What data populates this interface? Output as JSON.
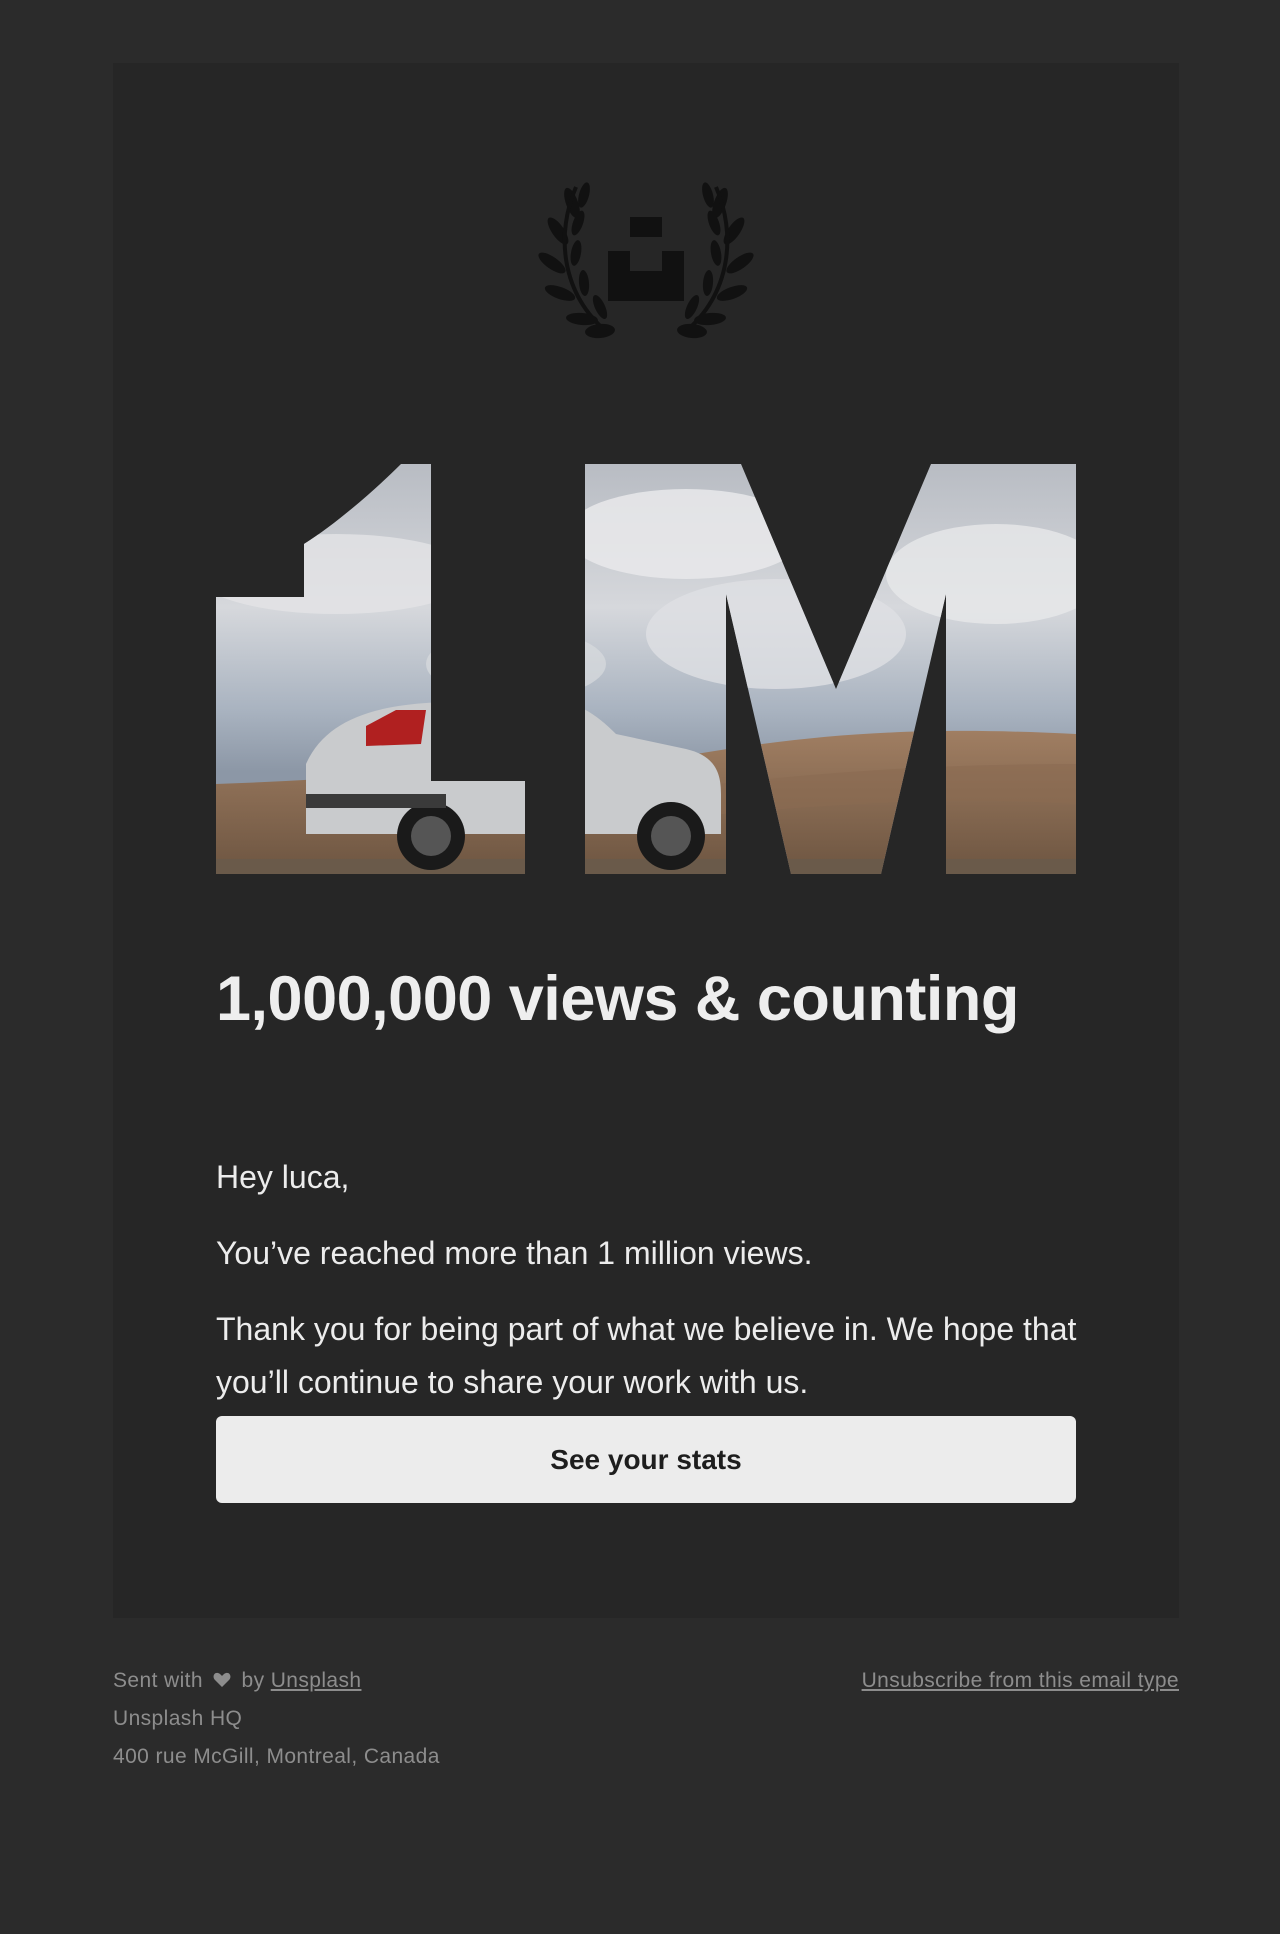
{
  "email": {
    "logo_icon": "unsplash-laurel-icon",
    "hero_text": "1M",
    "headline": "1,000,000 views & counting",
    "greeting": "Hey luca,",
    "message": "You’ve reached more than 1 million views.",
    "thanks": "Thank you for being part of what we believe in. We hope that you’ll continue to share your work with us.",
    "cta_label": "See your stats"
  },
  "footer": {
    "sent_with": "Sent with",
    "heart_icon": "heart-icon",
    "by": "by",
    "brand_link": "Unsplash",
    "hq": "Unsplash HQ",
    "address": "400 rue McGill, Montreal, Canada",
    "unsubscribe": "Unsubscribe from this email type"
  },
  "colors": {
    "page_bg": "#2b2b2b",
    "card_bg": "#262626",
    "text": "#ececec",
    "button_bg": "#ececec",
    "footer_text": "#8d8d8d"
  }
}
